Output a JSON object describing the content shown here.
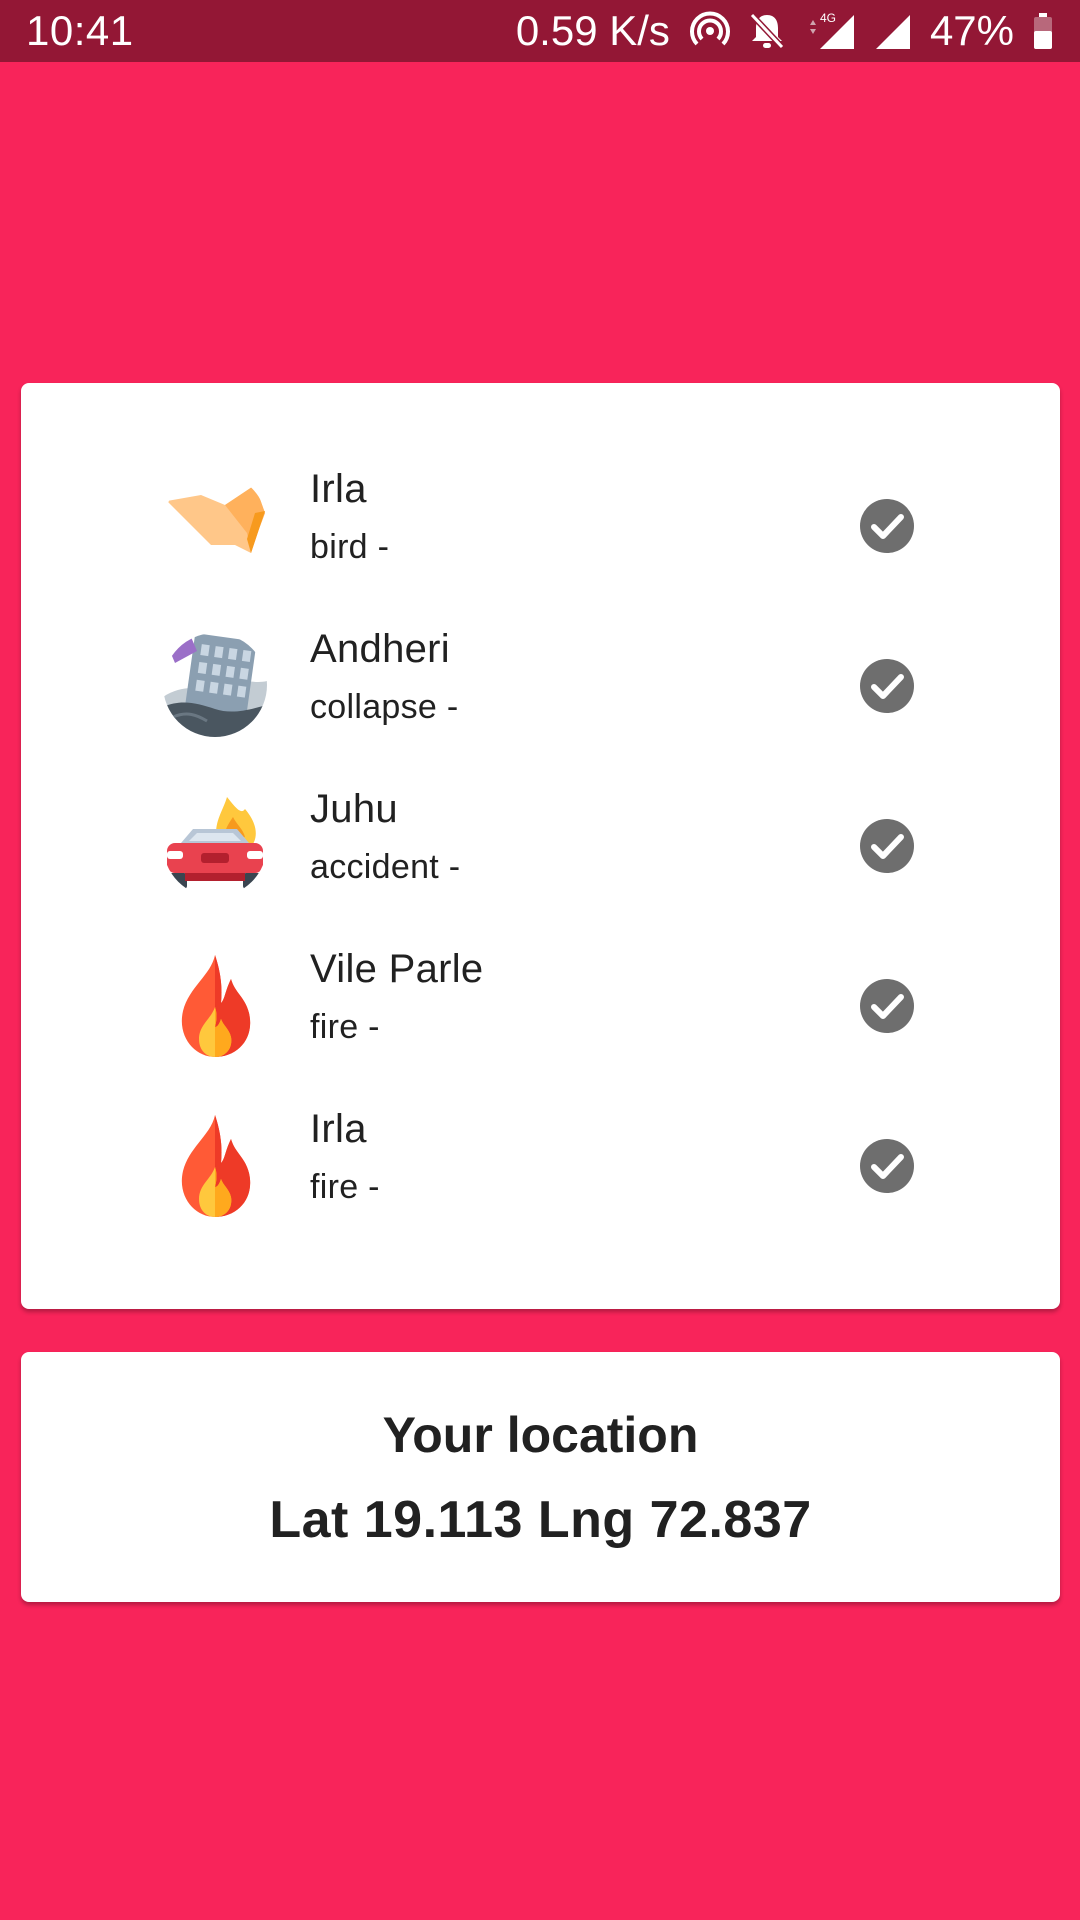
{
  "status_bar": {
    "time": "10:41",
    "net_speed": "0.59 K/s",
    "battery": "47%",
    "network_type": "4G",
    "icons": [
      "hotspot-icon",
      "bell-off-icon",
      "signal-icon",
      "signal-icon",
      "battery-icon"
    ]
  },
  "incidents": [
    {
      "place": "Irla",
      "type": "bird -",
      "icon": "bird-icon",
      "checked": true
    },
    {
      "place": "Andheri",
      "type": "collapse -",
      "icon": "building-collapse-icon",
      "checked": true
    },
    {
      "place": "Juhu",
      "type": "accident -",
      "icon": "car-accident-icon",
      "checked": true
    },
    {
      "place": "Vile Parle",
      "type": "fire -",
      "icon": "fire-icon",
      "checked": true
    },
    {
      "place": "Irla",
      "type": "fire -",
      "icon": "fire-icon",
      "checked": true
    }
  ],
  "location": {
    "title": "Your location",
    "coords": "Lat 19.113 Lng 72.837"
  },
  "colors": {
    "background": "#F8245A",
    "status_bar": "#931735",
    "check": "#6E6E6E"
  }
}
